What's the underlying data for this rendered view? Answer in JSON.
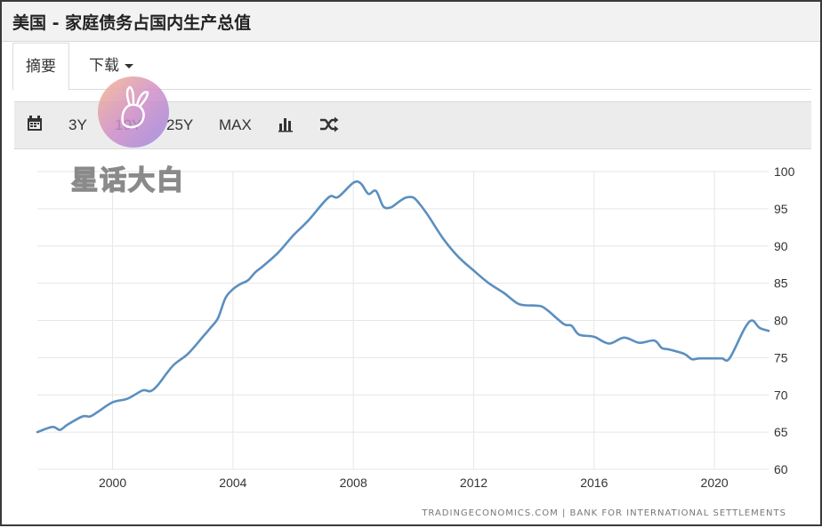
{
  "header": {
    "title": "美国 - 家庭债务占国内生产总值"
  },
  "tabs": [
    {
      "label": "摘要",
      "active": true
    },
    {
      "label": "下载",
      "active": false
    }
  ],
  "toolbar": {
    "calendar_icon": "calendar-icon",
    "ranges": [
      "3Y",
      "10Y",
      "25Y",
      "MAX"
    ],
    "chart_type_icon": "bar-chart-icon",
    "compare_icon": "shuffle-icon"
  },
  "watermark": {
    "text": "星话大白"
  },
  "source": "TRADINGECONOMICS.COM  |  BANK FOR INTERNATIONAL SETTLEMENTS",
  "colors": {
    "line": "#5b8fbf",
    "grid": "#e6e6e6",
    "toolbar_bg": "#ececec"
  },
  "chart_data": {
    "type": "line",
    "title": "",
    "xlabel": "",
    "ylabel": "",
    "xlim": [
      1997.5,
      2021.8
    ],
    "ylim": [
      60,
      100
    ],
    "x_ticks": [
      2000,
      2004,
      2008,
      2012,
      2016,
      2020
    ],
    "y_ticks": [
      60,
      65,
      70,
      75,
      80,
      85,
      90,
      95,
      100
    ],
    "grid": true,
    "y_axis_side": "right",
    "series": [
      {
        "x": [
          1997.5,
          1998.0,
          1998.25,
          1998.5,
          1999.0,
          1999.25,
          1999.5,
          2000.0,
          2000.5,
          2001.0,
          2001.25,
          2001.5,
          2002.0,
          2002.5,
          2003.0,
          2003.25,
          2003.5,
          2003.75,
          2004.0,
          2004.25,
          2004.5,
          2004.75,
          2005.0,
          2005.5,
          2006.0,
          2006.5,
          2007.0,
          2007.25,
          2007.5,
          2008.0,
          2008.25,
          2008.5,
          2008.75,
          2009.0,
          2009.25,
          2009.5,
          2009.75,
          2010.0,
          2010.25,
          2010.5,
          2011.0,
          2011.5,
          2012.0,
          2012.5,
          2013.0,
          2013.5,
          2014.0,
          2014.25,
          2014.5,
          2015.0,
          2015.25,
          2015.5,
          2016.0,
          2016.5,
          2017.0,
          2017.5,
          2018.0,
          2018.25,
          2018.5,
          2019.0,
          2019.25,
          2019.5,
          2020.0,
          2020.25,
          2020.5,
          2021.0,
          2021.25,
          2021.5,
          2021.8
        ],
        "values": [
          65.0,
          65.7,
          65.3,
          66.0,
          67.1,
          67.1,
          67.7,
          69.0,
          69.5,
          70.6,
          70.5,
          71.3,
          73.9,
          75.5,
          77.8,
          79.0,
          80.3,
          83.0,
          84.2,
          84.9,
          85.4,
          86.5,
          87.3,
          89.1,
          91.4,
          93.4,
          95.8,
          96.7,
          96.6,
          98.5,
          98.4,
          97.0,
          97.4,
          95.3,
          95.2,
          95.9,
          96.5,
          96.5,
          95.4,
          94.0,
          90.9,
          88.5,
          86.7,
          85.0,
          83.7,
          82.2,
          82.0,
          81.9,
          81.2,
          79.5,
          79.3,
          78.1,
          77.8,
          76.9,
          77.7,
          77.0,
          77.3,
          76.3,
          76.1,
          75.5,
          74.8,
          74.9,
          74.9,
          74.9,
          74.9,
          78.9,
          80.0,
          79.0,
          78.6
        ]
      }
    ]
  }
}
